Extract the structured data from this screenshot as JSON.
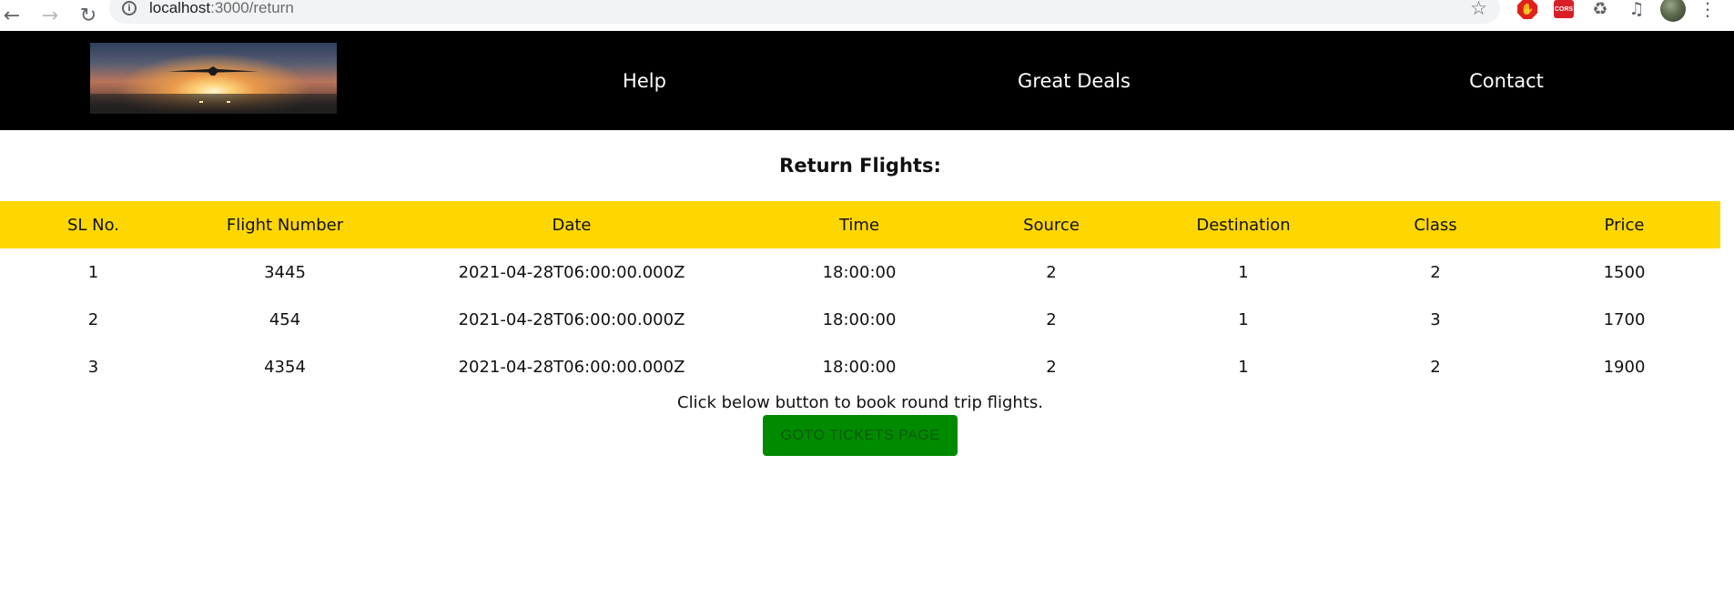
{
  "browser": {
    "url_host": "localhost",
    "url_path": ":3000/return",
    "icons": [
      "back-arrow-icon",
      "forward-arrow-icon",
      "reload-icon",
      "info-icon",
      "star-icon",
      "adblock-icon",
      "cors-icon",
      "puzzle-icon",
      "media-icon",
      "avatar",
      "kebab-menu-icon"
    ],
    "cors_badge": "CORS"
  },
  "header": {
    "nav": {
      "help": "Help",
      "deals": "Great Deals",
      "contact": "Contact"
    },
    "background_color": "#000000"
  },
  "main": {
    "title": "Return Flights:",
    "table": {
      "header_color": "#ffd700",
      "columns": [
        "SL No.",
        "Flight Number",
        "Date",
        "Time",
        "Source",
        "Destination",
        "Class",
        "Price"
      ],
      "rows": [
        [
          "1",
          "3445",
          "2021-04-28T06:00:00.000Z",
          "18:00:00",
          "2",
          "1",
          "2",
          "1500"
        ],
        [
          "2",
          "454",
          "2021-04-28T06:00:00.000Z",
          "18:00:00",
          "2",
          "1",
          "3",
          "1700"
        ],
        [
          "3",
          "4354",
          "2021-04-28T06:00:00.000Z",
          "18:00:00",
          "2",
          "1",
          "2",
          "1900"
        ]
      ]
    },
    "hint": "Click below button to book round trip flights.",
    "goto_button": "GOTO TICKETS PAGE",
    "goto_button_color": "#008a00"
  }
}
